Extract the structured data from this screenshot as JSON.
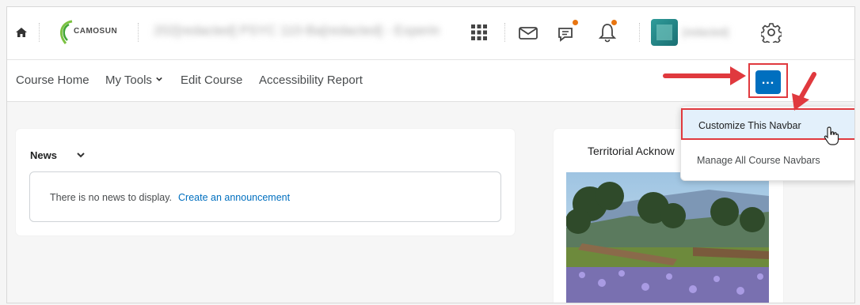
{
  "header": {
    "logo_text": "CAMOSUN",
    "course_title": "202[redacted] PSYC 110-Ba[redacted] - Experiment...",
    "username": "[redacted]"
  },
  "navbar": {
    "items": [
      {
        "label": "Course Home"
      },
      {
        "label": "My Tools"
      },
      {
        "label": "Edit Course"
      },
      {
        "label": "Accessibility Report"
      }
    ],
    "more_label": "..."
  },
  "dropdown": {
    "items": [
      {
        "label": "Customize This Navbar"
      },
      {
        "label": "Manage All Course Navbars"
      }
    ]
  },
  "news": {
    "title": "News",
    "empty_text": "There is no news to display.",
    "link_text": "Create an announcement"
  },
  "acknowledgement": {
    "title": "Territorial Acknow"
  },
  "colors": {
    "accent": "#006fbf",
    "annotation_red": "#e0393e",
    "notification": "#e87511"
  }
}
